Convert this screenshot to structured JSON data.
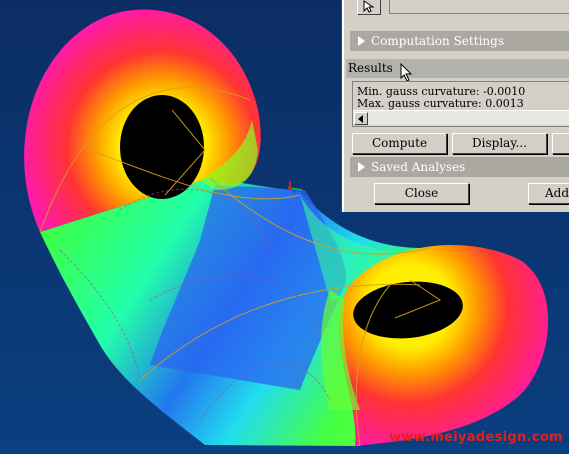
{
  "panel": {
    "sections": {
      "computation_settings": "Computation Settings",
      "saved_analyses": "Saved Analyses"
    },
    "results_title": "Results",
    "results": {
      "min_gauss": "Min. gauss curvature: -0.0010",
      "max_gauss": "Max. gauss curvature: 0.0013"
    },
    "buttons": {
      "compute": "Compute",
      "display": "Display...",
      "close": "Close",
      "add": "Add I"
    }
  },
  "watermark": "www.meiyadesign.com",
  "colors": {
    "background_top": "#0b2d63",
    "background_bottom": "#0a3f80",
    "panel_bg": "#d4d0c8",
    "section_bar": "#aaa8a0",
    "watermark": "#e02020"
  },
  "icons": [
    "arrow-cursor-icon",
    "mouse-pointer-icon",
    "axis-triad-icon"
  ]
}
